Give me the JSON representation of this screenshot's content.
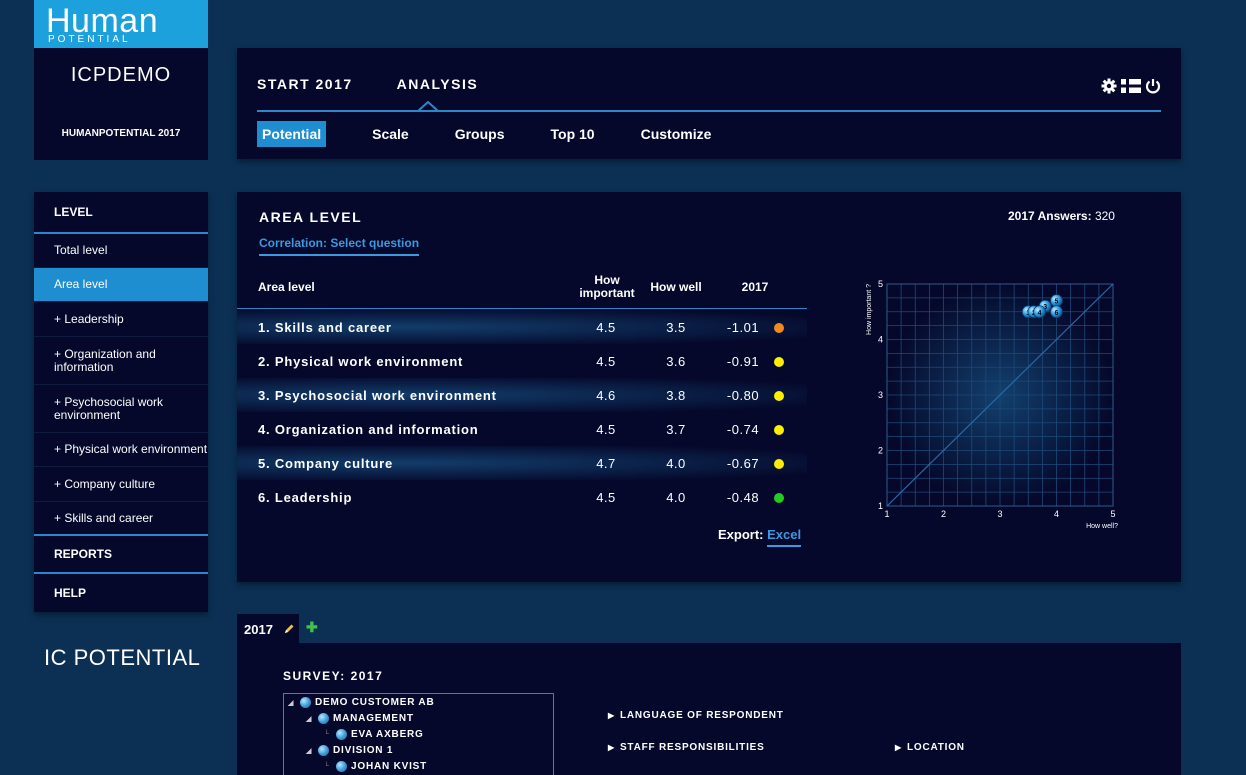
{
  "logo": {
    "brand_line1": "Human",
    "brand_line2": "POTENTIAL",
    "tm": "tm",
    "demo": "ICPDEMO",
    "project": "HUMANPOTENTIAL 2017"
  },
  "nav": {
    "main": [
      "START 2017",
      "ANALYSIS"
    ],
    "sub": [
      "Potential",
      "Scale",
      "Groups",
      "Top 10",
      "Customize"
    ],
    "active_sub": "Potential",
    "icons": [
      "gear-icon",
      "flag-icon",
      "power-icon"
    ]
  },
  "sidebar": {
    "level_header": "LEVEL",
    "items": [
      "Total level",
      "Area level",
      "+ Leadership",
      "+ Organization and information",
      "+ Psychosocial work environment",
      "+ Physical work environment",
      "+ Company culture",
      "+ Skills and career"
    ],
    "active_item": "Area level",
    "reports": "REPORTS",
    "help": "HELP"
  },
  "ic_logo": "IC POTENTIAL",
  "main": {
    "title": "AREA LEVEL",
    "answers_label": "2017 Answers:",
    "answers_value": "320",
    "correlation_link": "Correlation: Select question",
    "table": {
      "headers": [
        "Area level",
        "How important",
        "How well",
        "2017"
      ],
      "rows": [
        {
          "name": "1. Skills and career",
          "important": "4.5",
          "well": "3.5",
          "diff": "-1.01",
          "status_color": "#f08a1c"
        },
        {
          "name": "2. Physical work environment",
          "important": "4.5",
          "well": "3.6",
          "diff": "-0.91",
          "status_color": "#ffee00"
        },
        {
          "name": "3. Psychosocial work environment",
          "important": "4.6",
          "well": "3.8",
          "diff": "-0.80",
          "status_color": "#ffee00"
        },
        {
          "name": "4. Organization and information",
          "important": "4.5",
          "well": "3.7",
          "diff": "-0.74",
          "status_color": "#ffee00"
        },
        {
          "name": "5. Company culture",
          "important": "4.7",
          "well": "4.0",
          "diff": "-0.67",
          "status_color": "#ffee00"
        },
        {
          "name": "6. Leadership",
          "important": "4.5",
          "well": "4.0",
          "diff": "-0.48",
          "status_color": "#22cc22"
        }
      ]
    },
    "export_label": "Export:",
    "export_link": "Excel"
  },
  "chart_data": {
    "type": "scatter",
    "xlabel": "How well?",
    "ylabel": "How important ?",
    "xlim": [
      1,
      5
    ],
    "ylim": [
      1,
      5
    ],
    "xticks": [
      "1",
      "2",
      "3",
      "4",
      "5"
    ],
    "yticks": [
      "1",
      "2",
      "3",
      "4",
      "5"
    ],
    "grid": true,
    "diagonal": true,
    "points": [
      {
        "label": "1",
        "x": 3.5,
        "y": 4.5
      },
      {
        "label": "2",
        "x": 3.6,
        "y": 4.5
      },
      {
        "label": "3",
        "x": 3.8,
        "y": 4.6
      },
      {
        "label": "4",
        "x": 3.7,
        "y": 4.5
      },
      {
        "label": "5",
        "x": 4.0,
        "y": 4.7
      },
      {
        "label": "6",
        "x": 4.0,
        "y": 4.5
      }
    ]
  },
  "bottom": {
    "tab_label": "2017",
    "survey_title": "SURVEY: 2017",
    "tree": [
      {
        "label": "DEMO CUSTOMER AB",
        "depth": 0,
        "expandable": true
      },
      {
        "label": "MANAGEMENT",
        "depth": 1,
        "expandable": true
      },
      {
        "label": "EVA AXBERG",
        "depth": 2,
        "expandable": false
      },
      {
        "label": "DIVISION 1",
        "depth": 1,
        "expandable": true
      },
      {
        "label": "JOHAN KVIST",
        "depth": 2,
        "expandable": false
      }
    ],
    "filters": [
      "LANGUAGE OF RESPONDENT",
      "STAFF RESPONSIBILITIES",
      "LOCATION"
    ]
  }
}
